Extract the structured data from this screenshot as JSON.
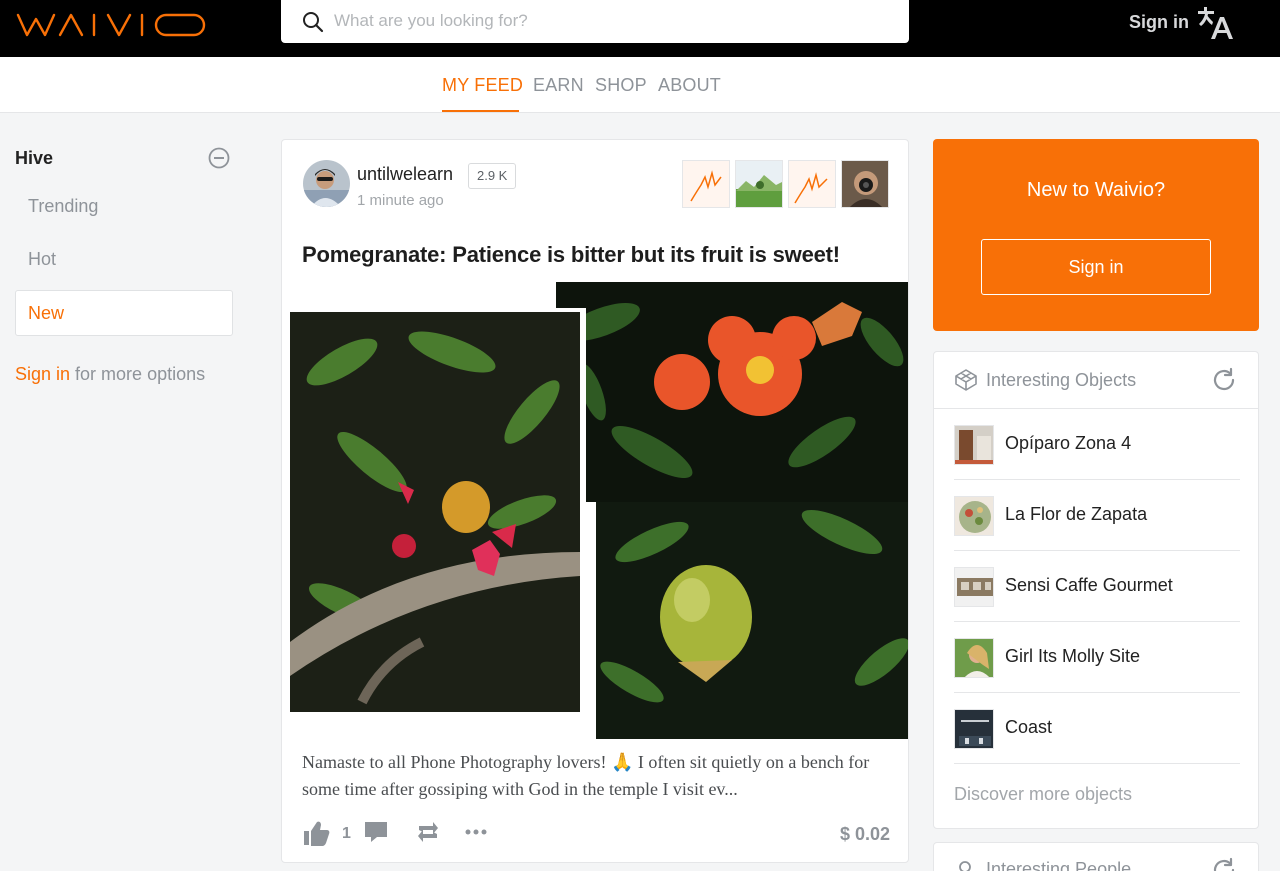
{
  "header": {
    "logo_text": "WAIVIO",
    "search_placeholder": "What are you looking for?",
    "search_value": "",
    "signin_label": "Sign in",
    "language_icon": "translate-icon"
  },
  "nav": {
    "tabs": [
      {
        "label": "MY FEED",
        "active": true
      },
      {
        "label": "EARN",
        "active": false
      },
      {
        "label": "SHOP",
        "active": false
      },
      {
        "label": "ABOUT",
        "active": false
      }
    ]
  },
  "sidebar": {
    "title": "Hive",
    "items": [
      {
        "label": "Trending"
      },
      {
        "label": "Hot"
      },
      {
        "label": "New",
        "active": true
      }
    ],
    "signin_link": "Sign in",
    "signin_suffix": " for more options"
  },
  "post": {
    "author": "untilwelearn",
    "reputation": "2.9 K",
    "time": "1 minute ago",
    "title": "Pomegranate: Patience is bitter but its fruit is sweet!",
    "excerpt": "Namaste to all Phone Photography lovers! 🙏 I often sit quietly on a bench for some time after gossiping with God in the temple I visit ev...",
    "likes": "1",
    "payout": "$ 0.02"
  },
  "promo": {
    "title": "New to Waivio?",
    "button": "Sign in"
  },
  "objects": {
    "title": "Interesting Objects",
    "items": [
      {
        "name": "Opíparo Zona 4"
      },
      {
        "name": "La Flor de Zapata"
      },
      {
        "name": "Sensi Caffe Gourmet"
      },
      {
        "name": "Girl Its Molly Site"
      },
      {
        "name": "Coast"
      }
    ],
    "discover": "Discover more objects"
  },
  "people": {
    "title": "Interesting People"
  },
  "colors": {
    "accent": "#f87007",
    "topbar": "#000000",
    "muted": "#8e9399"
  }
}
